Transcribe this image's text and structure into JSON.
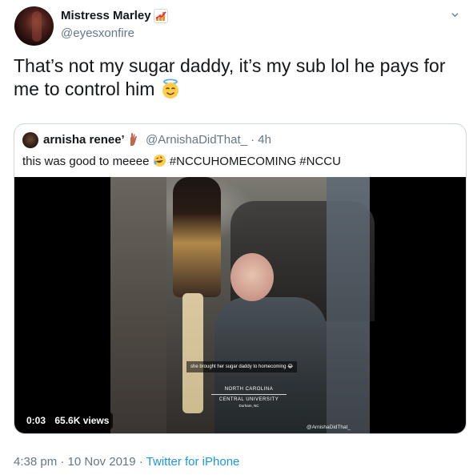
{
  "author": {
    "display_name": "Mistress Marley",
    "handle": "@eyesxonfire",
    "name_emoji": "chart-increasing-emoji"
  },
  "tweet": {
    "text": "That’s not my sugar daddy, it’s my sub lol he pays for me to control him",
    "emoji": "smiling-face-with-halo-emoji"
  },
  "quoted": {
    "display_name": "arnisha renee’",
    "name_emoji": "hand-emoji",
    "handle": "@ArnishaDidThat_",
    "separator": "·",
    "time": "4h",
    "text_before": "this was good to meeee",
    "text_after": "#NCCUHOMECOMING #NCCU",
    "emoji": "rolling-on-floor-laughing-emoji",
    "video": {
      "caption": "she brought her sugar daddy to homecoming 😂",
      "logo_line1": "NORTH CAROLINA",
      "logo_line2": "CENTRAL UNIVERSITY",
      "logo_line3": "Durham, NC",
      "watermark": "@ArnishaDidThat_",
      "time": "0:03",
      "views": "65.6K views"
    }
  },
  "footer": {
    "timestamp": "4:38 pm · 10 Nov 2019 · ",
    "source": "Twitter for iPhone"
  },
  "colors": {
    "text": "#14171a",
    "secondary": "#657786",
    "link": "#1b95e0",
    "border": "#ccd6dd"
  }
}
